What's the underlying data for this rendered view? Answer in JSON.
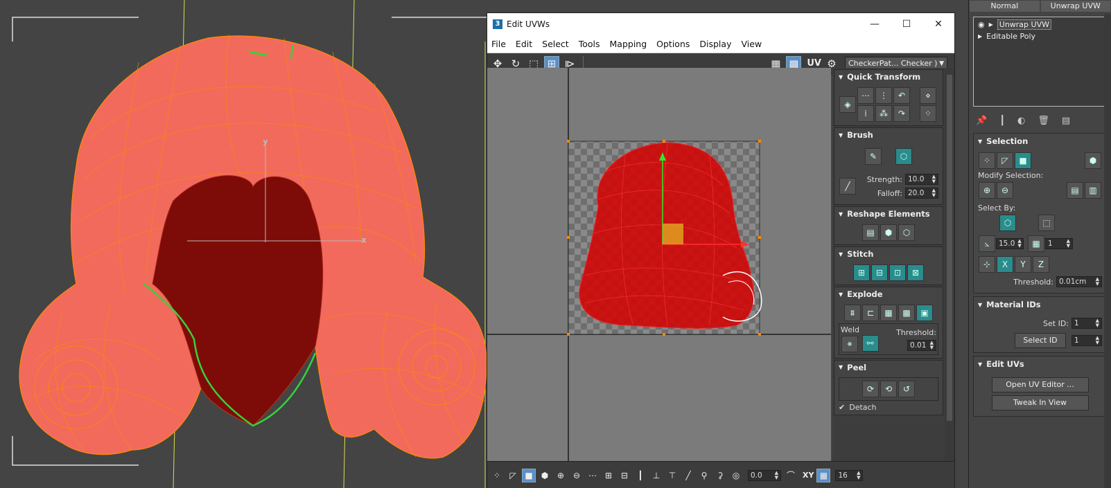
{
  "viewport": {
    "label": "3D viewport - hair mesh"
  },
  "uvw": {
    "title": "Edit UVWs",
    "app_icon": "3",
    "window_buttons": [
      "—",
      "☐",
      "✕"
    ],
    "menu": [
      "File",
      "Edit",
      "Select",
      "Tools",
      "Mapping",
      "Options",
      "Display",
      "View"
    ],
    "uv_label": "UV",
    "texture_select": "CheckerPat... Checker )",
    "rollouts": {
      "quick_transform": "Quick Transform",
      "brush": "Brush",
      "brush_strength_label": "Strength:",
      "brush_strength": "10.0",
      "brush_falloff_label": "Falloff:",
      "brush_falloff": "20.0",
      "reshape": "Reshape Elements",
      "stitch": "Stitch",
      "explode": "Explode",
      "weld_label": "Weld",
      "weld_threshold_label": "Threshold:",
      "weld_threshold": "0.01",
      "peel": "Peel",
      "detach_label": "Detach"
    },
    "bottom": {
      "value_a": "0.0",
      "xy_label": "XY",
      "value_b": "16"
    }
  },
  "cmd": {
    "tabs": [
      "Normal",
      "Unwrap UVW"
    ],
    "stack": [
      {
        "label": "Unwrap UVW",
        "selected": true
      },
      {
        "label": "Editable Poly",
        "selected": false
      }
    ],
    "selection": {
      "title": "Selection",
      "modify_label": "Modify Selection:",
      "select_by_label": "Select By:",
      "angle_value": "15.0",
      "count_value": "1",
      "threshold_label": "Threshold:",
      "threshold_value": "0.01cm"
    },
    "material_ids": {
      "title": "Material IDs",
      "set_id_label": "Set ID:",
      "set_id_value": "1",
      "select_id_button": "Select ID",
      "select_id_value": "1"
    },
    "edit_uvs": {
      "title": "Edit UVs",
      "open_editor_button": "Open UV Editor ...",
      "tweak_button": "Tweak In View"
    }
  },
  "colors": {
    "mesh": "#f26a5c",
    "wire": "#ff8a00",
    "seam": "#39d13a",
    "accent": "#2a8c8c"
  }
}
